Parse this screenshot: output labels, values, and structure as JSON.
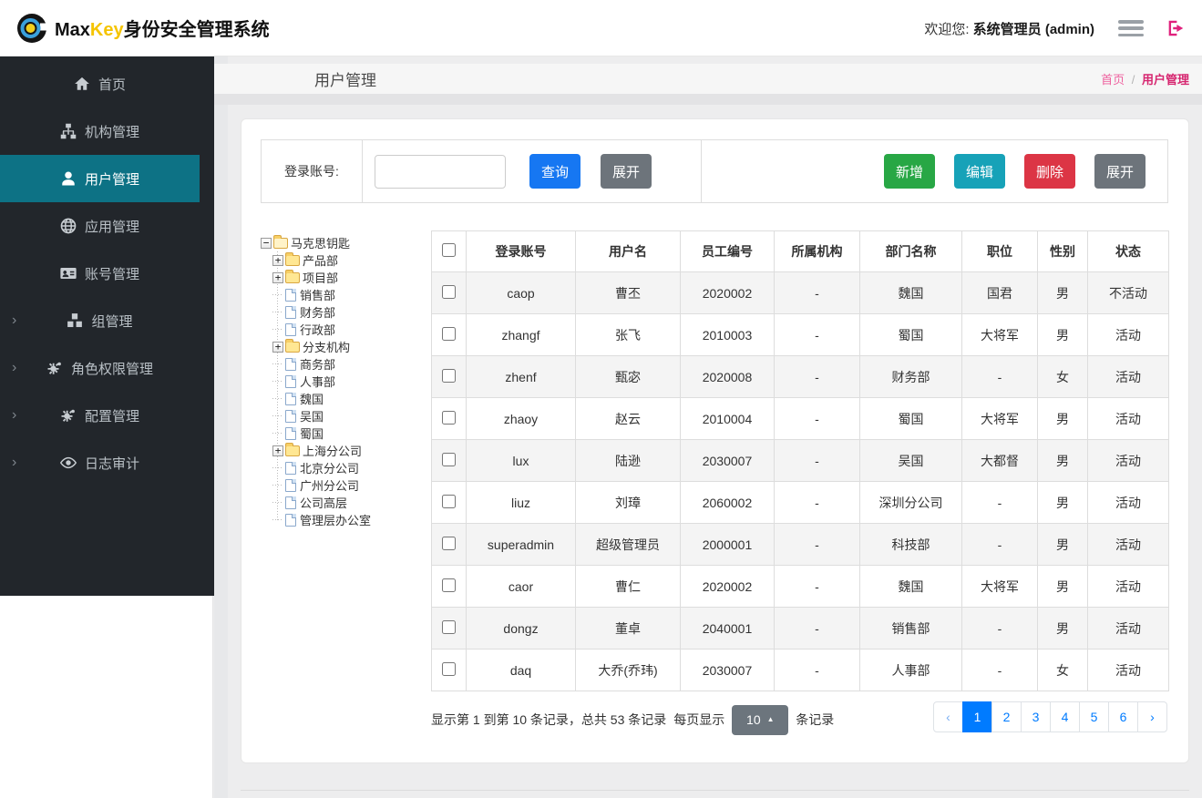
{
  "header": {
    "logo_max": "Max",
    "logo_key": "Key",
    "logo_suffix": "身份安全管理系统",
    "welcome_label": "欢迎您:",
    "username": "系统管理员 (admin)"
  },
  "sidebar": {
    "items": [
      {
        "label": "首页",
        "icon": "home",
        "active": false,
        "has_submenu": false
      },
      {
        "label": "机构管理",
        "icon": "sitemap",
        "active": false,
        "has_submenu": false
      },
      {
        "label": "用户管理",
        "icon": "user",
        "active": true,
        "has_submenu": false
      },
      {
        "label": "应用管理",
        "icon": "globe",
        "active": false,
        "has_submenu": false
      },
      {
        "label": "账号管理",
        "icon": "id-card",
        "active": false,
        "has_submenu": false
      },
      {
        "label": "组管理",
        "icon": "cubes",
        "active": false,
        "has_submenu": true
      },
      {
        "label": "角色权限管理",
        "icon": "gears",
        "active": false,
        "has_submenu": true
      },
      {
        "label": "配置管理",
        "icon": "gears",
        "active": false,
        "has_submenu": true
      },
      {
        "label": "日志审计",
        "icon": "eye",
        "active": false,
        "has_submenu": true
      }
    ]
  },
  "page": {
    "title": "用户管理",
    "breadcrumb_home": "首页",
    "breadcrumb_sep": "/",
    "breadcrumb_current": "用户管理"
  },
  "toolbar": {
    "search_label": "登录账号:",
    "search_value": "",
    "query_label": "查询",
    "expand_label": "展开",
    "add_label": "新增",
    "edit_label": "编辑",
    "delete_label": "删除",
    "expand2_label": "展开"
  },
  "tree": {
    "root": "马克思钥匙",
    "nodes": [
      {
        "label": "产品部",
        "type": "folder"
      },
      {
        "label": "项目部",
        "type": "folder"
      },
      {
        "label": "销售部",
        "type": "leaf"
      },
      {
        "label": "财务部",
        "type": "leaf"
      },
      {
        "label": "行政部",
        "type": "leaf"
      },
      {
        "label": "分支机构",
        "type": "folder"
      },
      {
        "label": "商务部",
        "type": "leaf"
      },
      {
        "label": "人事部",
        "type": "leaf"
      },
      {
        "label": "魏国",
        "type": "leaf"
      },
      {
        "label": "吴国",
        "type": "leaf"
      },
      {
        "label": "蜀国",
        "type": "leaf"
      },
      {
        "label": "上海分公司",
        "type": "folder"
      },
      {
        "label": "北京分公司",
        "type": "leaf"
      },
      {
        "label": "广州分公司",
        "type": "leaf"
      },
      {
        "label": "公司高层",
        "type": "leaf"
      },
      {
        "label": "管理层办公室",
        "type": "leaf"
      }
    ]
  },
  "table": {
    "columns": [
      "登录账号",
      "用户名",
      "员工编号",
      "所属机构",
      "部门名称",
      "职位",
      "性别",
      "状态"
    ],
    "rows": [
      [
        "caop",
        "曹丕",
        "2020002",
        "-",
        "魏国",
        "国君",
        "男",
        "不活动"
      ],
      [
        "zhangf",
        "张飞",
        "2010003",
        "-",
        "蜀国",
        "大将军",
        "男",
        "活动"
      ],
      [
        "zhenf",
        "甄宓",
        "2020008",
        "-",
        "财务部",
        "-",
        "女",
        "活动"
      ],
      [
        "zhaoy",
        "赵云",
        "2010004",
        "-",
        "蜀国",
        "大将军",
        "男",
        "活动"
      ],
      [
        "lux",
        "陆逊",
        "2030007",
        "-",
        "吴国",
        "大都督",
        "男",
        "活动"
      ],
      [
        "liuz",
        "刘璋",
        "2060002",
        "-",
        "深圳分公司",
        "-",
        "男",
        "活动"
      ],
      [
        "superadmin",
        "超级管理员",
        "2000001",
        "-",
        "科技部",
        "-",
        "男",
        "活动"
      ],
      [
        "caor",
        "曹仁",
        "2020002",
        "-",
        "魏国",
        "大将军",
        "男",
        "活动"
      ],
      [
        "dongz",
        "董卓",
        "2040001",
        "-",
        "销售部",
        "-",
        "男",
        "活动"
      ],
      [
        "daq",
        "大乔(乔玮)",
        "2030007",
        "-",
        "人事部",
        "-",
        "女",
        "活动"
      ]
    ]
  },
  "pagination": {
    "info": "显示第 1 到第 10 条记录，总共 53 条记录",
    "per_page_before": "每页显示",
    "page_size": "10",
    "per_page_after": "条记录",
    "prev": "‹",
    "next": "›",
    "pages": [
      "1",
      "2",
      "3",
      "4",
      "5",
      "6"
    ],
    "active_page": "1"
  },
  "colors": {
    "sidebar_bg": "#22262b",
    "sidebar_active": "#0d7285",
    "primary_blue": "#1677f2",
    "success_green": "#28a745",
    "info_teal": "#17a2b8",
    "danger_red": "#dc3545",
    "secondary_gray": "#6d747b",
    "pagination_blue": "#007bff",
    "breadcrumb_pink": "#d6256f",
    "logo_yellow": "#f5c400"
  }
}
